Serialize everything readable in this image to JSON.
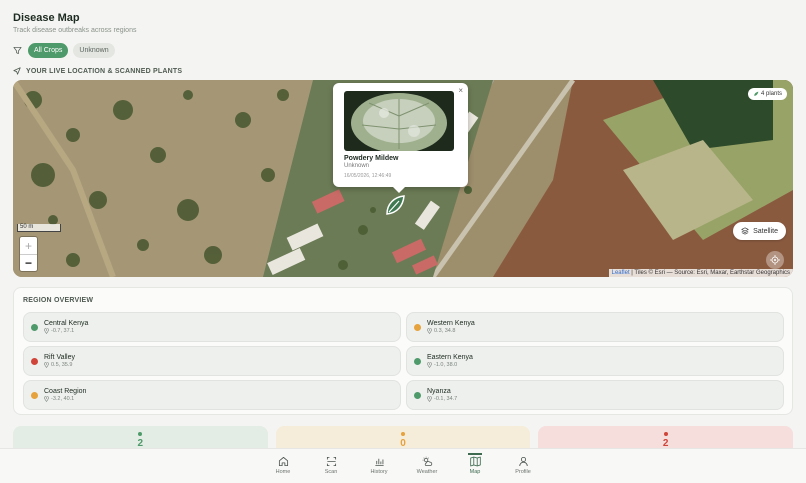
{
  "header": {
    "title": "Disease Map",
    "subtitle": "Track disease outbreaks across regions"
  },
  "filters": {
    "icon": "filter-icon",
    "chips": [
      "All Crops",
      "Unknown"
    ],
    "active": "All Crops"
  },
  "section_label": "YOUR LIVE LOCATION & SCANNED PLANTS",
  "map": {
    "scale": "50 m",
    "zoom_in": "+",
    "zoom_out": "−",
    "plants_badge": "4 plants",
    "satellite_label": "Satellite",
    "attribution_link": "Leaflet",
    "attribution_text": "| Tiles © Esri — Source: Esri, Maxar, Earthstar Geographics",
    "popup": {
      "close": "×",
      "disease": "Powdery Mildew",
      "crop": "Unknown",
      "timestamp": "16/05/2026, 12:46:49"
    }
  },
  "region_overview": {
    "title": "REGION OVERVIEW",
    "regions": [
      {
        "name": "Central Kenya",
        "coords": "-0.7, 37.1",
        "status_color": "#4f9a6a"
      },
      {
        "name": "Western Kenya",
        "coords": "0.3, 34.8",
        "status_color": "#e6a23c"
      },
      {
        "name": "Rift Valley",
        "coords": "0.5, 35.9",
        "status_color": "#d0443a"
      },
      {
        "name": "Eastern Kenya",
        "coords": "-1.0, 38.0",
        "status_color": "#4f9a6a"
      },
      {
        "name": "Coast Region",
        "coords": "-3.2, 40.1",
        "status_color": "#e6a23c"
      },
      {
        "name": "Nyanza",
        "coords": "-0.1, 34.7",
        "status_color": "#4f9a6a"
      }
    ]
  },
  "stats": [
    {
      "value": "2",
      "color": "#4f9a6a",
      "bg": "#e3ece5"
    },
    {
      "value": "0",
      "color": "#e6a23c",
      "bg": "#f6ecda"
    },
    {
      "value": "2",
      "color": "#d0443a",
      "bg": "#f5dedb"
    }
  ],
  "nav": [
    {
      "label": "Home",
      "icon": "home-icon"
    },
    {
      "label": "Scan",
      "icon": "scan-icon"
    },
    {
      "label": "History",
      "icon": "history-chart-icon"
    },
    {
      "label": "Weather",
      "icon": "weather-icon"
    },
    {
      "label": "Map",
      "icon": "map-icon",
      "active": true
    },
    {
      "label": "Profile",
      "icon": "profile-icon"
    }
  ]
}
